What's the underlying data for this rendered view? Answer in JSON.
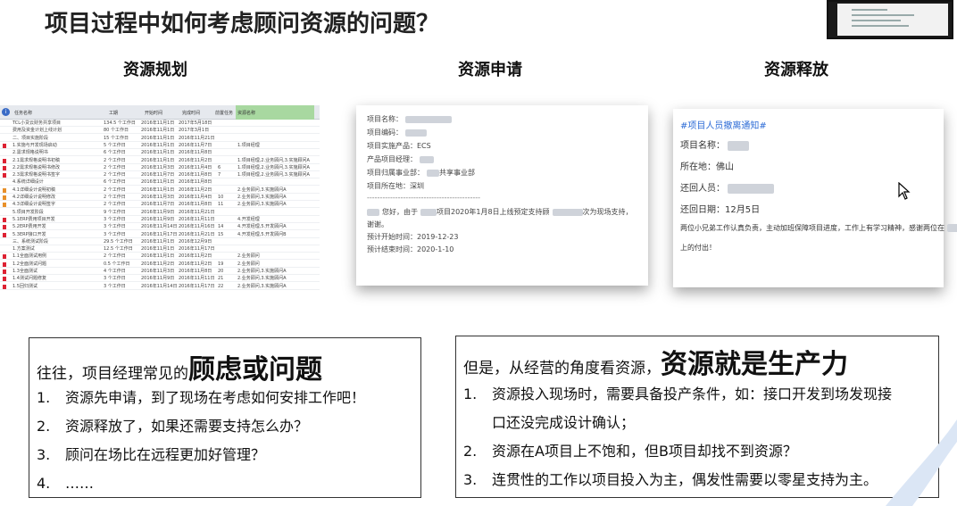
{
  "slide": {
    "title": "项目过程中如何考虑顾问资源的问题？"
  },
  "columns": {
    "planning": "资源规划",
    "request": "资源申请",
    "release": "资源释放"
  },
  "sheet": {
    "headers": [
      "任务名称",
      "工期",
      "开始时间",
      "完成时间",
      "前置任务",
      "资源名称"
    ],
    "rows": [
      {
        "name": "TCL小贷云财务共享项目",
        "dur": "134.5 个工作日",
        "start": "2016年11月1日",
        "end": "2017年5月18日",
        "pre": "",
        "res": "",
        "flag": ""
      },
      {
        "name": "费用及资金计划上线计划",
        "dur": "80 个工作日",
        "start": "2016年11月1日",
        "end": "2017年3月1日",
        "pre": "",
        "res": "",
        "flag": ""
      },
      {
        "name": "二、项目实施阶段",
        "dur": "15 个工作日",
        "start": "2016年11月1日",
        "end": "2016年11月21日",
        "pre": "",
        "res": "",
        "flag": ""
      },
      {
        "name": "1.实施与开发现场启动",
        "dur": "5 个工作日",
        "start": "2016年11月1日",
        "end": "2016年11月7日",
        "pre": "",
        "res": "1.项目经理",
        "flag": "red"
      },
      {
        "name": "2.需求规格说明书",
        "dur": "6 个工作日",
        "start": "2016年11月1日",
        "end": "2016年11月8日",
        "pre": "",
        "res": "",
        "flag": ""
      },
      {
        "name": "2.1需求规格说明书初稿",
        "dur": "2 个工作日",
        "start": "2016年11月1日",
        "end": "2016年11月2日",
        "pre": "",
        "res": "1.项目经理,2.业务顾问,3.实施顾问A",
        "flag": "red"
      },
      {
        "name": "2.2需求规格说明书修改",
        "dur": "2 个工作日",
        "start": "2016年11月3日",
        "end": "2016年11月4日",
        "pre": "6",
        "res": "1.项目经理,2.业务顾问,3.实施顾问A",
        "flag": "red"
      },
      {
        "name": "2.3需求规格说明书签字",
        "dur": "2 个工作日",
        "start": "2016年11月7日",
        "end": "2016年11月8日",
        "pre": "7",
        "res": "1.项目经理,2.业务顾问,3.实施顾问A",
        "flag": "red"
      },
      {
        "name": "4.系统详细设计",
        "dur": "6 个工作日",
        "start": "2016年11月1日",
        "end": "2016年11月8日",
        "pre": "",
        "res": "",
        "flag": ""
      },
      {
        "name": "4.1详细设计说明初稿",
        "dur": "2 个工作日",
        "start": "2016年11月1日",
        "end": "2016年11月2日",
        "pre": "",
        "res": "2.业务顾问,3.实施顾问A",
        "flag": "orange"
      },
      {
        "name": "4.2详细设计说明修改",
        "dur": "2 个工作日",
        "start": "2016年11月3日",
        "end": "2016年11月4日",
        "pre": "10",
        "res": "2.业务顾问,3.实施顾问A",
        "flag": "orange"
      },
      {
        "name": "4.3详细设计说明签字",
        "dur": "2 个工作日",
        "start": "2016年11月7日",
        "end": "2016年11月8日",
        "pre": "11",
        "res": "2.业务顾问,3.实施顾问A",
        "flag": "orange"
      },
      {
        "name": "5.项目开发阶段",
        "dur": "9 个工作日",
        "start": "2016年11月9日",
        "end": "2016年11月21日",
        "pre": "",
        "res": "",
        "flag": ""
      },
      {
        "name": "5.1ERP费用项目开发",
        "dur": "3 个工作日",
        "start": "2016年11月9日",
        "end": "2016年11月11日",
        "pre": "",
        "res": "4.开发经理",
        "flag": "red"
      },
      {
        "name": "5.2ERP费用开发",
        "dur": "3 个工作日",
        "start": "2016年11月14日",
        "end": "2016年11月16日",
        "pre": "14",
        "res": "4.开发经理,5.开发顾问A",
        "flag": "red"
      },
      {
        "name": "5.3ERP接口开发",
        "dur": "3 个工作日",
        "start": "2016年11月17日",
        "end": "2016年11月21日",
        "pre": "15",
        "res": "4.开发经理,5.开发顾问B",
        "flag": "red"
      },
      {
        "name": "三、系统测试阶段",
        "dur": "29.5 个工作日",
        "start": "2016年11月1日",
        "end": "2016年12月9日",
        "pre": "",
        "res": "",
        "flag": ""
      },
      {
        "name": "1.方案测试",
        "dur": "12.5 个工作日",
        "start": "2016年11月1日",
        "end": "2016年11月17日",
        "pre": "",
        "res": "",
        "flag": ""
      },
      {
        "name": "1.1全面测试用例",
        "dur": "2 个工作日",
        "start": "2016年11月1日",
        "end": "2016年11月2日",
        "pre": "",
        "res": "2.业务顾问",
        "flag": "red"
      },
      {
        "name": "1.2全面测试问题",
        "dur": "0.5 个工作日",
        "start": "2016年11月2日",
        "end": "2016年11月2日",
        "pre": "19",
        "res": "2.业务顾问",
        "flag": "red"
      },
      {
        "name": "1.3全面测试",
        "dur": "4 个工作日",
        "start": "2016年11月3日",
        "end": "2016年11月8日",
        "pre": "20",
        "res": "2.业务顾问,3.实施顾问A",
        "flag": "red"
      },
      {
        "name": "1.4测试问题修复",
        "dur": "3 个工作日",
        "start": "2016年11月9日",
        "end": "2016年11月11日",
        "pre": "21",
        "res": "2.业务顾问,3.实施顾问A",
        "flag": "red"
      },
      {
        "name": "1.5回归测试",
        "dur": "3 个工作日",
        "start": "2016年11月14日",
        "end": "2016年11月17日",
        "pre": "22",
        "res": "2.业务顾问,3.实施顾问A",
        "flag": "red"
      }
    ]
  },
  "request_doc": {
    "lines": [
      "项目名称：",
      "项目编码：",
      "项目实施产品：ECS",
      "产品项目经理：",
      "项目归属事业部：",
      "项目所在地：深圳",
      "--------------------------------------------",
      "您好，由于",
      "谢谢。",
      "预计开始时间：2019-12-23",
      "预计结束时间：2020-1-10"
    ],
    "division_suffix": "共享事业部",
    "reason_text": "项目2020年1月8日上线预定支持顾",
    "reason_tail": "次为现场支持，"
  },
  "release_doc": {
    "hashtag": "#项目人员撤离通知#",
    "project_name": "项目名称：",
    "location": "所在地：佛山",
    "returnee": "还回人员：",
    "return_date": "还回日期：12月5日",
    "thanks": "两位小兄弟工作认真负责，主动加班保障项目进度，工作上有学习精神，感谢两位在",
    "thanks_tail": "项目",
    "thanks_end": "上的付出！"
  },
  "left_box": {
    "lead": "往往，项目经理常见的",
    "emphasis": "顾虑或问题",
    "items": [
      {
        "num": "1.",
        "text": "资源先申请，到了现场在考虑如何安排工作吧！"
      },
      {
        "num": "2.",
        "text": "资源释放了，如果还需要支持怎么办？"
      },
      {
        "num": "3.",
        "text": "顾问在场比在远程更加好管理？"
      },
      {
        "num": "4.",
        "text": "……"
      }
    ]
  },
  "right_box": {
    "lead": "但是，从经营的角度看资源，",
    "emphasis": "资源就是生产力",
    "items": [
      {
        "num": "1.",
        "text": "资源投入现场时，需要具备投产条件，如：接口开发到场发现接",
        "cont": "口还没完成设计确认；"
      },
      {
        "num": "2.",
        "text": "资源在A项目上不饱和，但B项目却找不到资源？"
      },
      {
        "num": "3.",
        "text": "连贯性的工作以项目投入为主，偶发性需要以零星支持为主。"
      }
    ]
  },
  "colors": {
    "accent_green": "#a8d8a0",
    "flag_red": "#dd2233",
    "hashtag_blue": "#2c6bd6"
  }
}
